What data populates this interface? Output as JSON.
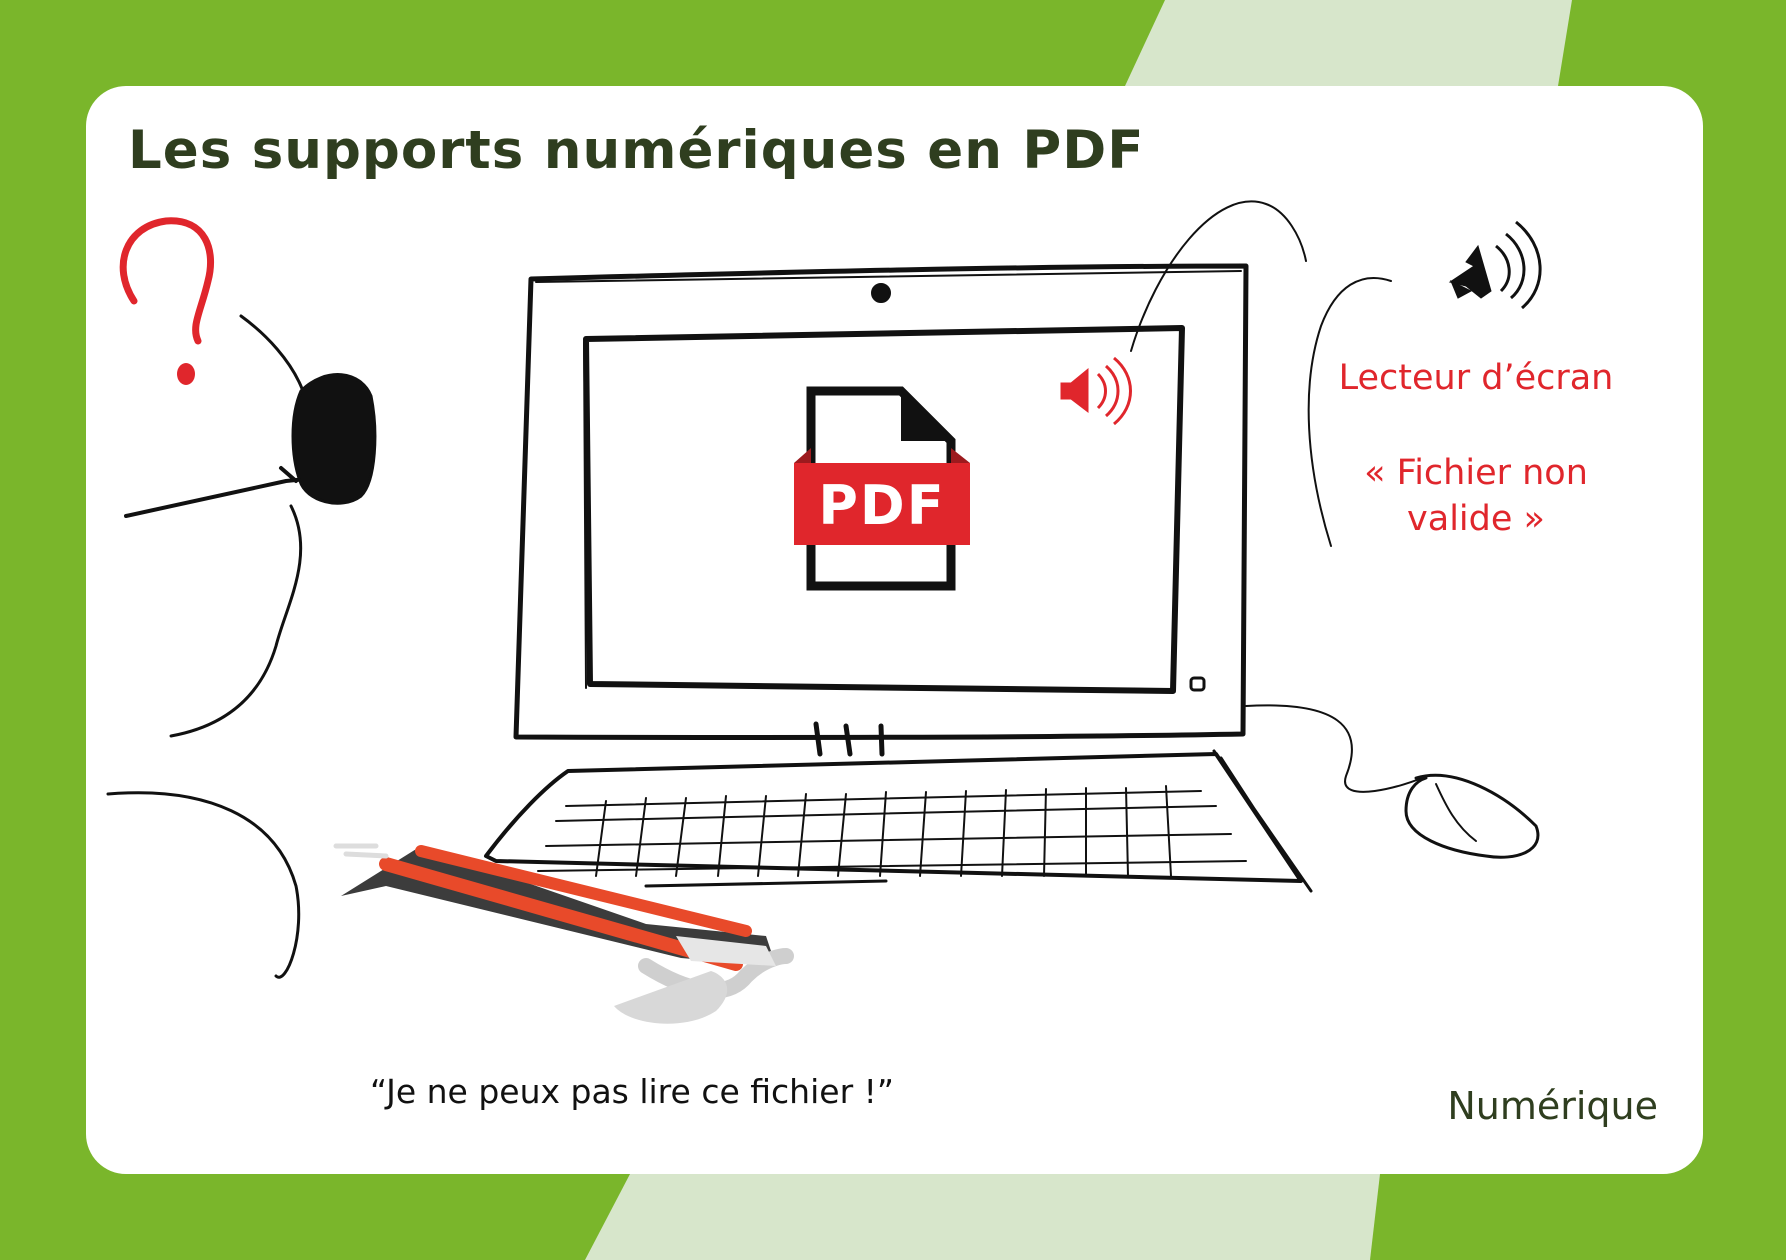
{
  "title": "Les supports numériques en PDF",
  "screen_reader": {
    "label": "Lecteur d’écran",
    "message_line1": "« Fichier non",
    "message_line2": "valide »"
  },
  "file_icon": {
    "label": "PDF",
    "name": "pdf-file-icon"
  },
  "quote": "“Je ne peux pas lire ce fichier !”",
  "category": "Numérique",
  "colors": {
    "frame_green": "#7ab62b",
    "stripe_light_green": "#d7e6cb",
    "title_dark_green": "#2f3e1f",
    "accent_red": "#e0262c",
    "card_white": "#ffffff"
  },
  "icons": [
    "question-mark-icon",
    "speaker-icon",
    "pdf-file-icon",
    "white-cane-icon",
    "computer-monitor-icon",
    "keyboard-icon",
    "mouse-icon"
  ]
}
